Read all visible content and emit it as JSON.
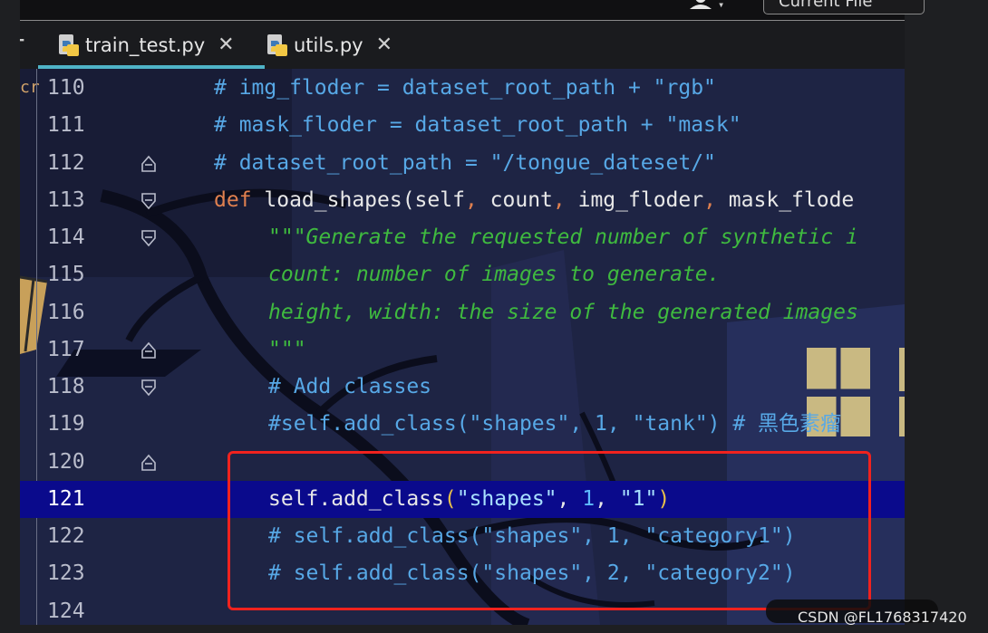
{
  "topbar": {
    "current_file_label": "Current File"
  },
  "tabs": [
    {
      "label": "train_test.py",
      "active": true,
      "icon": "python-file-icon"
    },
    {
      "label": "utils.py",
      "active": false,
      "icon": "python-file-icon"
    }
  ],
  "editor": {
    "left_fragment": "cr",
    "current_line": 121,
    "lines": [
      {
        "number": "110",
        "text": "# img_floder = dataset_root_path + \"rgb\""
      },
      {
        "number": "111",
        "text": "# mask_floder = dataset_root_path + \"mask\""
      },
      {
        "number": "112",
        "text": "# dataset_root_path = \"/tongue_dateset/\""
      },
      {
        "number": "113",
        "kw": "def ",
        "text": "load_shapes(self",
        "comma1": ",",
        "t2": " count",
        "comma2": ",",
        "t3": " img_floder",
        "comma3": ",",
        "t4": " mask_flode"
      },
      {
        "number": "114",
        "text": "\"\"\"Generate the requested number of synthetic i"
      },
      {
        "number": "115",
        "text": "count: number of images to generate."
      },
      {
        "number": "116",
        "text": "height, width: the size of the generated images"
      },
      {
        "number": "117",
        "text": "\"\"\""
      },
      {
        "number": "118",
        "text": "# Add classes"
      },
      {
        "number": "119",
        "text": "#self.add_class(\"shapes\", 1, \"tank\") # 黑色素瘤"
      },
      {
        "number": "120",
        "text": ""
      },
      {
        "number": "121",
        "p1": "self.add_class",
        "p2": "(",
        "p3": "\"shapes\"",
        "p4": ", ",
        "p5": "1",
        "p6": ", ",
        "p7": "\"1\"",
        "p8": ")"
      },
      {
        "number": "122",
        "text": "# self.add_class(\"shapes\", 1, \"category1\")"
      },
      {
        "number": "123",
        "text": "# self.add_class(\"shapes\", 2, \"category2\")"
      },
      {
        "number": "124",
        "text": ""
      }
    ]
  },
  "watermark": "CSDN @FL1768317420",
  "colors": {
    "comment": "#57a8e6",
    "keyword": "#e0804f",
    "docstring": "#3fba3f",
    "current_line_bg": "#0a0a8c",
    "active_tab_underline": "#4fb3c6",
    "highlight_box": "#f0221e"
  }
}
